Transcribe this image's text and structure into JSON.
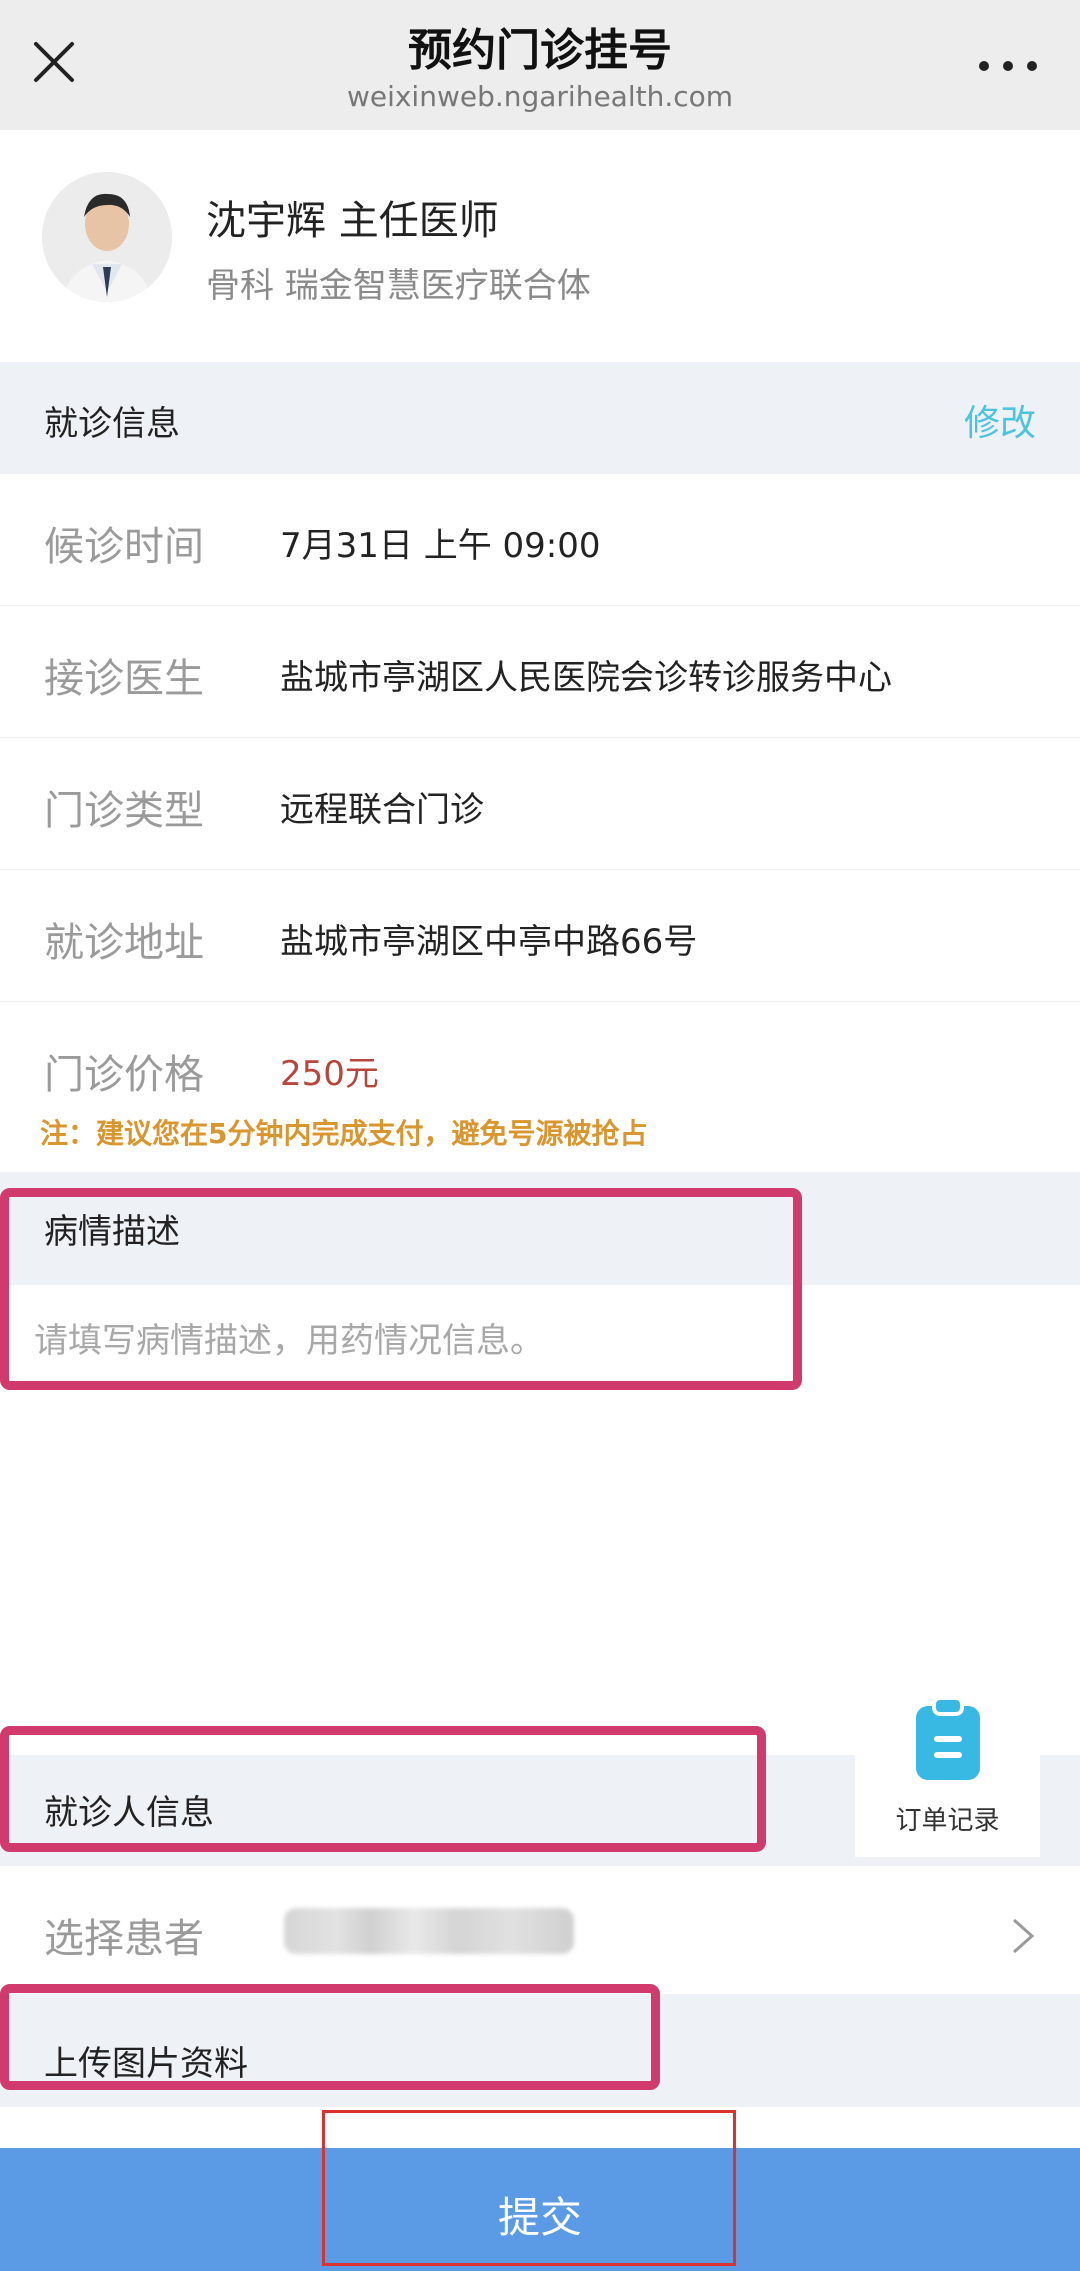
{
  "header": {
    "title": "预约门诊挂号",
    "domain": "weixinweb.ngarihealth.com"
  },
  "doctor": {
    "name_title": "沈宇辉  主任医师",
    "department_org": "骨科  瑞金智慧医疗联合体"
  },
  "visit_info": {
    "section_title": "就诊信息",
    "edit_label": "修改",
    "rows": [
      {
        "label": "候诊时间",
        "value": "7月31日 上午 09:00"
      },
      {
        "label": "接诊医生",
        "value": "盐城市亭湖区人民医院会诊转诊服务中心"
      },
      {
        "label": "门诊类型",
        "value": "远程联合门诊"
      },
      {
        "label": "就诊地址",
        "value": "盐城市亭湖区中亭中路66号"
      },
      {
        "label": "门诊价格",
        "value": "250元"
      }
    ],
    "note": "注：建议您在5分钟内完成支付，避免号源被抢占"
  },
  "condition": {
    "section_title": "病情描述",
    "placeholder": "请填写病情描述，用药情况信息。"
  },
  "order_record": {
    "label": "订单记录",
    "icon": "clipboard-icon"
  },
  "patient": {
    "section_title": "就诊人信息",
    "select_label": "选择患者"
  },
  "upload": {
    "section_title": "上传图片资料"
  },
  "submit": {
    "label": "提交"
  },
  "colors": {
    "accent": "#5b9be6",
    "edit": "#4cc4de",
    "price": "#b8473b",
    "note": "#d9952e",
    "highlight": "#d03a6c"
  }
}
